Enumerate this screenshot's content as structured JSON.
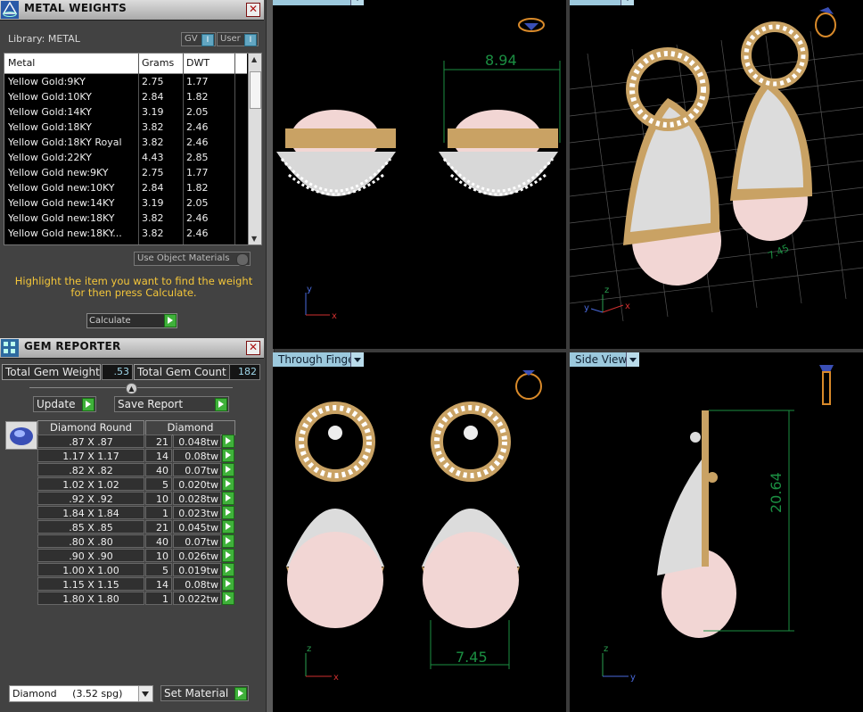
{
  "metal_panel": {
    "title": "METAL WEIGHTS",
    "library_label": "Library: METAL",
    "gv_label": "GV",
    "user_label": "User",
    "columns": [
      "Metal",
      "Grams",
      "DWT"
    ],
    "rows": [
      {
        "metal": "Yellow Gold:9KY",
        "grams": "2.75",
        "dwt": "1.77"
      },
      {
        "metal": "Yellow Gold:10KY",
        "grams": "2.84",
        "dwt": "1.82"
      },
      {
        "metal": "Yellow Gold:14KY",
        "grams": "3.19",
        "dwt": "2.05"
      },
      {
        "metal": "Yellow Gold:18KY",
        "grams": "3.82",
        "dwt": "2.46"
      },
      {
        "metal": "Yellow Gold:18KY Royal",
        "grams": "3.82",
        "dwt": "2.46"
      },
      {
        "metal": "Yellow Gold:22KY",
        "grams": "4.43",
        "dwt": "2.85"
      },
      {
        "metal": "Yellow Gold new:9KY",
        "grams": "2.75",
        "dwt": "1.77"
      },
      {
        "metal": "Yellow Gold new:10KY",
        "grams": "2.84",
        "dwt": "1.82"
      },
      {
        "metal": "Yellow Gold new:14KY",
        "grams": "3.19",
        "dwt": "2.05"
      },
      {
        "metal": "Yellow Gold new:18KY",
        "grams": "3.82",
        "dwt": "2.46"
      },
      {
        "metal": "Yellow Gold new:18KY...",
        "grams": "3.82",
        "dwt": "2.46"
      }
    ],
    "use_object_materials": "Use Object Materials",
    "instruction": "Highlight the item you want to find the weight for then press Calculate.",
    "calculate_label": "Calculate"
  },
  "gem_panel": {
    "title": "GEM REPORTER",
    "total_weight_label": "Total Gem Weight",
    "total_weight_value": ".53",
    "total_count_label": "Total Gem Count",
    "total_count_value": "182",
    "update_label": "Update",
    "save_report_label": "Save Report",
    "col_shape": "Diamond Round",
    "col_material": "Diamond",
    "rows": [
      {
        "size": ".87 X .87",
        "count": "21",
        "weight": "0.048tw"
      },
      {
        "size": "1.17 X 1.17",
        "count": "14",
        "weight": "0.08tw"
      },
      {
        "size": ".82 X .82",
        "count": "40",
        "weight": "0.07tw"
      },
      {
        "size": "1.02 X 1.02",
        "count": "5",
        "weight": "0.020tw"
      },
      {
        "size": ".92 X .92",
        "count": "10",
        "weight": "0.028tw"
      },
      {
        "size": "1.84 X 1.84",
        "count": "1",
        "weight": "0.023tw"
      },
      {
        "size": ".85 X .85",
        "count": "21",
        "weight": "0.045tw"
      },
      {
        "size": ".80 X .80",
        "count": "40",
        "weight": "0.07tw"
      },
      {
        "size": ".90 X .90",
        "count": "10",
        "weight": "0.026tw"
      },
      {
        "size": "1.00 X 1.00",
        "count": "5",
        "weight": "0.019tw"
      },
      {
        "size": "1.15 X 1.15",
        "count": "14",
        "weight": "0.08tw"
      },
      {
        "size": "1.80 X 1.80",
        "count": "1",
        "weight": "0.022tw"
      }
    ],
    "material_select": "Diamond     (3.52 spg)",
    "set_material_label": "Set Material"
  },
  "viewports": {
    "through_finger": "Through Finger",
    "side_view": "Side View",
    "dim_top": "8.94",
    "dim_persp": "7.45",
    "dim_front": "7.45",
    "dim_side": "20.64"
  },
  "colors": {
    "accent_yellow": "#f4c63a",
    "viewport_label": "#9cc9dd",
    "dimension_green": "#1b8f42",
    "gold": "#c9a264",
    "pearl": "#f2d6d4"
  }
}
